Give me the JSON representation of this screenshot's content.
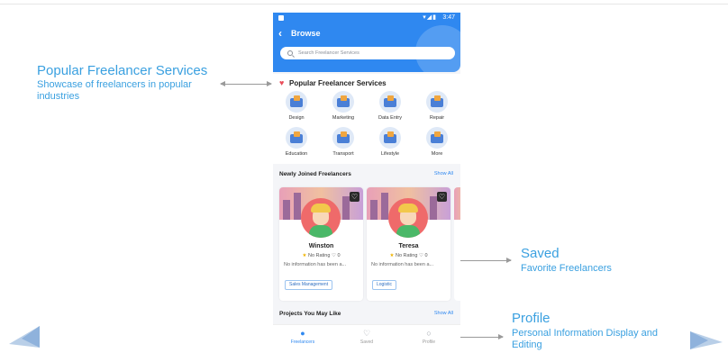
{
  "annotations": {
    "popular": {
      "title": "Popular Freelancer Services",
      "subtitle": "Showcase of freelancers in popular industries"
    },
    "saved": {
      "title": "Saved",
      "subtitle": "Favorite Freelancers"
    },
    "profile": {
      "title": "Profile",
      "subtitle": "Personal Information Display and Editing"
    }
  },
  "phone": {
    "status": {
      "time": "3:47",
      "icons": "▾◢▮"
    },
    "header": {
      "back_icon": "chevron-left-icon",
      "title": "Browse"
    },
    "search": {
      "placeholder": "Search Freelancer Services"
    },
    "popular": {
      "title": "Popular Freelancer Services",
      "categories": [
        {
          "label": "Design"
        },
        {
          "label": "Marketing"
        },
        {
          "label": "Data Entry"
        },
        {
          "label": "Repair"
        },
        {
          "label": "Education"
        },
        {
          "label": "Transport"
        },
        {
          "label": "Lifestyle"
        },
        {
          "label": "More"
        }
      ]
    },
    "newly": {
      "title": "Newly Joined Freelancers",
      "show_all": "Show All",
      "cards": [
        {
          "name": "Winston",
          "rating": "No Rating",
          "likes": "0",
          "info": "No information has been a...",
          "tag": "Sales Management"
        },
        {
          "name": "Teresa",
          "rating": "No Rating",
          "likes": "0",
          "info": "No information has been a...",
          "tag": "Logistic"
        }
      ]
    },
    "projects": {
      "title": "Projects You May Like",
      "show_all": "Show All"
    },
    "tabs": [
      {
        "label": "Freelancers",
        "icon": "person-icon",
        "active": true
      },
      {
        "label": "Saved",
        "icon": "heart-icon",
        "active": false
      },
      {
        "label": "Profile",
        "icon": "profile-icon",
        "active": false
      }
    ]
  },
  "colors": {
    "accent": "#2f88f0",
    "annotation": "#3aa0e0",
    "heart": "#e94d5a",
    "avatar_bg": "#ef6a6a"
  }
}
